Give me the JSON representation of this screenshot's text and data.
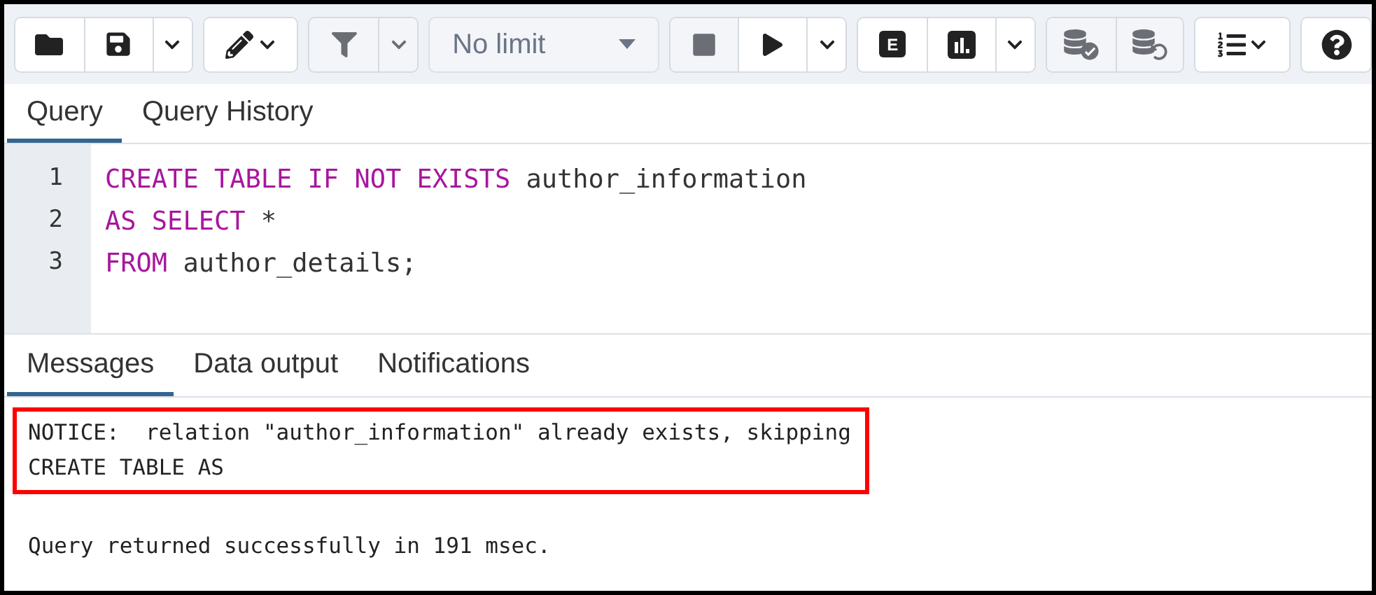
{
  "toolbar": [
    [
      {
        "kind": "folder",
        "disabled": false
      },
      {
        "kind": "save",
        "disabled": false
      },
      {
        "kind": "caret",
        "disabled": false
      }
    ],
    [
      {
        "kind": "pencil-caret",
        "disabled": false
      }
    ],
    [
      {
        "kind": "filter",
        "disabled": true
      },
      {
        "kind": "caret",
        "disabled": true
      }
    ],
    [
      {
        "kind": "select",
        "label": "No limit",
        "disabled": true
      }
    ],
    [
      {
        "kind": "stop",
        "disabled": true
      },
      {
        "kind": "play",
        "disabled": false
      },
      {
        "kind": "caret",
        "disabled": false
      }
    ],
    [
      {
        "kind": "letter",
        "label": "E",
        "disabled": false
      },
      {
        "kind": "chart",
        "disabled": false
      },
      {
        "kind": "caret",
        "disabled": false
      }
    ],
    [
      {
        "kind": "db-check",
        "disabled": true
      },
      {
        "kind": "db-undo",
        "disabled": true
      }
    ],
    [
      {
        "kind": "list-caret",
        "disabled": false
      }
    ],
    [
      {
        "kind": "help",
        "disabled": false
      }
    ]
  ],
  "editor_tabs": [
    {
      "label": "Query",
      "selected": true
    },
    {
      "label": "Query History",
      "selected": false
    }
  ],
  "code_lines": [
    {
      "number": "1",
      "tokens": [
        {
          "kind": "keyword",
          "text": "CREATE TABLE IF NOT EXISTS"
        },
        {
          "kind": "plain",
          "text": " author_information"
        }
      ]
    },
    {
      "number": "2",
      "tokens": [
        {
          "kind": "keyword",
          "text": "AS SELECT"
        },
        {
          "kind": "plain",
          "text": " *"
        }
      ]
    },
    {
      "number": "3",
      "tokens": [
        {
          "kind": "keyword",
          "text": "FROM"
        },
        {
          "kind": "plain",
          "text": " author_details;"
        }
      ]
    }
  ],
  "output_tabs": [
    {
      "label": "Messages",
      "selected": true
    },
    {
      "label": "Data output",
      "selected": false
    },
    {
      "label": "Notifications",
      "selected": false
    }
  ],
  "messages": {
    "highlighted": true,
    "lines": [
      "NOTICE:  relation \"author_information\" already exists, skipping",
      "CREATE TABLE AS"
    ]
  },
  "result": "Query returned successfully in 191 msec."
}
